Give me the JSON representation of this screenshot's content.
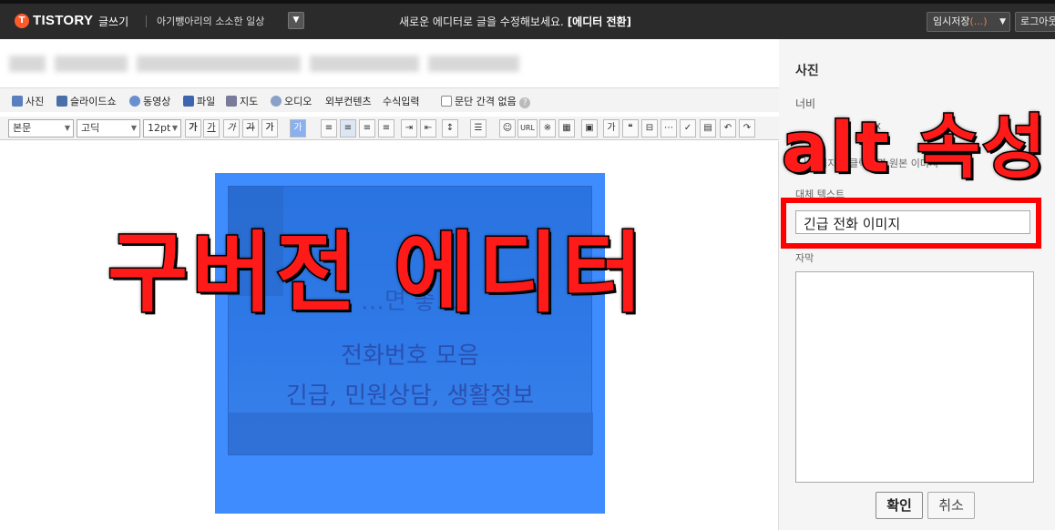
{
  "topbar": {
    "brand": "TISTORY",
    "write": "글쓰기",
    "blog_name": "아기뺑아리의 소소한 일상",
    "notice": "새로운 에디터로 글을 수정해보세요.",
    "notice_link": "[에디터 전환]",
    "save_label": "임시저장",
    "save_count": "(...)",
    "login_label": "로그아웃"
  },
  "toolbar1": {
    "items": [
      "사진",
      "슬라이드쇼",
      "동영상",
      "파일",
      "지도",
      "오디오",
      "외부컨텐츠",
      "수식입력",
      "문단 간격 없음"
    ]
  },
  "toolbar2": {
    "paragraph": "본문",
    "font": "고딕",
    "size": "12pt",
    "url": "URL"
  },
  "photo": {
    "line1": "…면 좋…",
    "line2": "전화번호 모음",
    "line3": "긴급, 민원상담, 생활정보"
  },
  "captions": {
    "main": "구버전 에디터",
    "alt": "alt 속성"
  },
  "panel": {
    "title": "사진",
    "width_label": "너비",
    "x_label": "x",
    "check_label": "이미지를 클릭하면 원본 이미지",
    "alt_label": "대체 텍스트",
    "alt_value": "긴급 전화 이미지",
    "caption_label": "자막",
    "ok": "확인",
    "cancel": "취소"
  },
  "colors": {
    "topbar_bg": "#2b2b2b",
    "brand_accent": "#ff5a2c",
    "photo_overlay": "#3f8cff",
    "highlight": "#ff0000"
  }
}
